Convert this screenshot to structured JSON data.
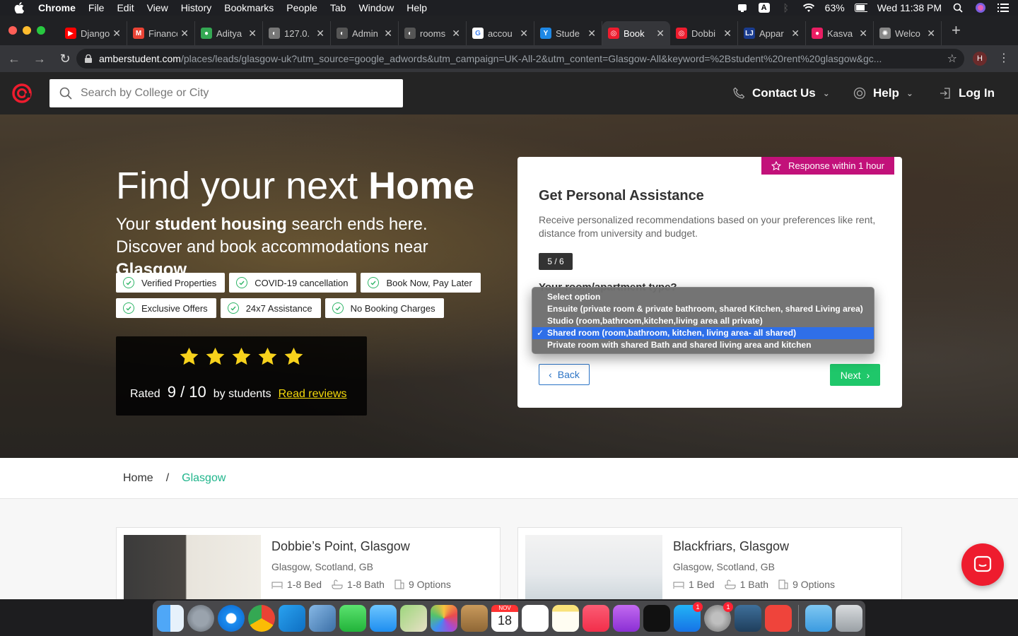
{
  "menubar": {
    "app": "Chrome",
    "items": [
      "File",
      "Edit",
      "View",
      "History",
      "Bookmarks",
      "People",
      "Tab",
      "Window",
      "Help"
    ],
    "battery": "63%",
    "clock": "Wed 11:38 PM",
    "input_source": "A"
  },
  "tabs": [
    {
      "title": "Django",
      "color": "#ff0000",
      "glyph": "▶"
    },
    {
      "title": "Finance",
      "color": "#ea4335",
      "glyph": "M"
    },
    {
      "title": "Aditya",
      "color": "#34a853",
      "glyph": "●"
    },
    {
      "title": "127.0.",
      "color": "#777777",
      "glyph": "◐"
    },
    {
      "title": "Admin",
      "color": "#555555",
      "glyph": "◐"
    },
    {
      "title": "rooms",
      "color": "#555555",
      "glyph": "◐"
    },
    {
      "title": "accou",
      "color": "#ffffff",
      "glyph": "G"
    },
    {
      "title": "Stude",
      "color": "#1e88e5",
      "glyph": "Y"
    },
    {
      "title": "Book",
      "color": "#ee1c2e",
      "glyph": "◎"
    },
    {
      "title": "Dobbi",
      "color": "#ee1c2e",
      "glyph": "◎"
    },
    {
      "title": "Appar",
      "color": "#1a3c8f",
      "glyph": "LJ"
    },
    {
      "title": "Kasva",
      "color": "#e91e63",
      "glyph": "●"
    },
    {
      "title": "Welco",
      "color": "#888888",
      "glyph": "✺"
    }
  ],
  "address": {
    "domain": "amberstudent.com",
    "path": "/places/leads/glasgow-uk?utm_source=google_adwords&utm_campaign=UK-All-2&utm_content=Glasgow-All&keyword=%2Bstudent%20rent%20glasgow&gc...",
    "profile_initial": "H"
  },
  "site": {
    "search_placeholder": "Search by College or City",
    "contact": "Contact Us",
    "help": "Help",
    "login": "Log In",
    "brand_color": "#ee1c2e"
  },
  "hero": {
    "title_prefix": "Find your next ",
    "title_bold": "Home",
    "sub_1": "Your ",
    "sub_bold_1": "student housing",
    "sub_2": " search ends here. Discover and book accommodations near ",
    "sub_bold_2": "Glasgow",
    "chips": [
      "Verified Properties",
      "COVID-19 cancellation",
      "Book Now, Pay Later",
      "Exclusive Offers",
      "24x7 Assistance",
      "No Booking Charges"
    ],
    "rating_prefix": "Rated",
    "rating_value": "9",
    "rating_max": "10",
    "rating_suffix": "by students",
    "reviews_link": "Read reviews",
    "stars": 5
  },
  "form": {
    "badge": "Response within 1 hour",
    "title": "Get Personal Assistance",
    "description": "Receive personalized recommendations based on your preferences like rent, distance from university and budget.",
    "step": "5 / 6",
    "question": "Your room/apartment type?",
    "back": "Back",
    "next": "Next",
    "options": [
      "Select option",
      "Ensuite (private room & private bathroom, shared Kitchen, shared Living area)",
      "Studio (room,bathroom,kitchen,living area all private)",
      "Shared room (room,bathroom, kitchen, living area- all shared)",
      "Private room with shared Bath and shared living area and kitchen"
    ],
    "selected_index": 3
  },
  "breadcrumb": {
    "home": "Home",
    "sep": "/",
    "current": "Glasgow"
  },
  "listings": [
    {
      "name": "Dobbie’s Point, Glasgow",
      "location": "Glasgow, Scotland, GB",
      "beds": "1-8 Bed",
      "baths": "1-8 Bath",
      "options": "9 Options"
    },
    {
      "name": "Blackfriars, Glasgow",
      "location": "Glasgow, Scotland, GB",
      "beds": "1 Bed",
      "baths": "1 Bath",
      "options": "9 Options"
    }
  ],
  "dock": {
    "calendar_month": "NOV",
    "calendar_day": "18",
    "appstore_badge": "1",
    "prefs_badge": "1",
    "icons": [
      "finder-icon",
      "launchpad-icon",
      "safari-icon",
      "chrome-icon",
      "vscode-icon",
      "preview-icon",
      "facetime-icon",
      "messages-icon",
      "maps-icon",
      "photos-icon",
      "contacts-icon",
      "calendar-icon",
      "reminders-icon",
      "notes-icon",
      "music-icon",
      "podcasts-icon",
      "tv-icon",
      "appstore-icon",
      "system-preferences-icon",
      "mysql-workbench-icon",
      "anydesk-icon",
      "downloads-folder-icon",
      "trash-icon"
    ]
  }
}
